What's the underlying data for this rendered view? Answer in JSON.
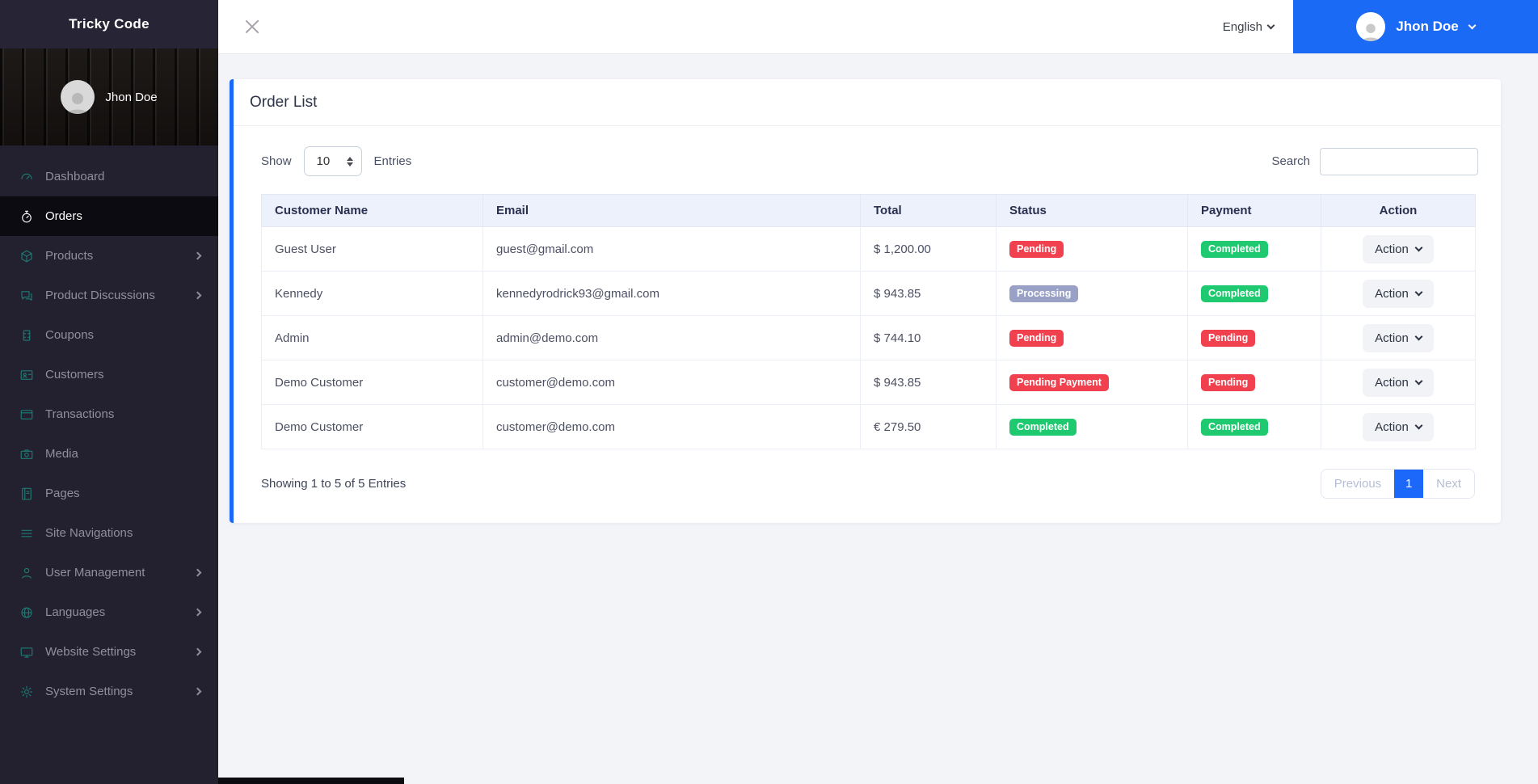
{
  "brand": "Tricky Code",
  "sidebar": {
    "user": {
      "name": "Jhon Doe"
    },
    "items": [
      {
        "label": "Dashboard",
        "icon": "gauge-icon",
        "active": false,
        "has_submenu": false
      },
      {
        "label": "Orders",
        "icon": "stopwatch-icon",
        "active": true,
        "has_submenu": false
      },
      {
        "label": "Products",
        "icon": "cube-icon",
        "active": false,
        "has_submenu": true
      },
      {
        "label": "Product Discussions",
        "icon": "chat-icon",
        "active": false,
        "has_submenu": true
      },
      {
        "label": "Coupons",
        "icon": "ticket-icon",
        "active": false,
        "has_submenu": false
      },
      {
        "label": "Customers",
        "icon": "id-card-icon",
        "active": false,
        "has_submenu": false
      },
      {
        "label": "Transactions",
        "icon": "credit-card-icon",
        "active": false,
        "has_submenu": false
      },
      {
        "label": "Media",
        "icon": "camera-icon",
        "active": false,
        "has_submenu": false
      },
      {
        "label": "Pages",
        "icon": "book-icon",
        "active": false,
        "has_submenu": false
      },
      {
        "label": "Site Navigations",
        "icon": "menu-lines-icon",
        "active": false,
        "has_submenu": false
      },
      {
        "label": "User Management",
        "icon": "person-icon",
        "active": false,
        "has_submenu": true
      },
      {
        "label": "Languages",
        "icon": "globe-icon",
        "active": false,
        "has_submenu": true
      },
      {
        "label": "Website Settings",
        "icon": "monitor-icon",
        "active": false,
        "has_submenu": true
      },
      {
        "label": "System Settings",
        "icon": "gear-icon",
        "active": false,
        "has_submenu": true
      }
    ]
  },
  "topbar": {
    "language": "English",
    "user_name": "Jhon Doe"
  },
  "page": {
    "card_title": "Order List",
    "show_label": "Show",
    "page_size": "10",
    "entries_label": "Entries",
    "search_label": "Search",
    "search_value": "",
    "table": {
      "columns": [
        "Customer Name",
        "Email",
        "Total",
        "Status",
        "Payment",
        "Action"
      ],
      "rows": [
        {
          "customer": "Guest User",
          "email": "guest@gmail.com",
          "total": "$ 1,200.00",
          "status": "Pending",
          "status_type": "danger",
          "payment": "Completed",
          "payment_type": "success",
          "action": "Action"
        },
        {
          "customer": "Kennedy",
          "email": "kennedyrodrick93@gmail.com",
          "total": "$ 943.85",
          "status": "Processing",
          "status_type": "processing",
          "payment": "Completed",
          "payment_type": "success",
          "action": "Action"
        },
        {
          "customer": "Admin",
          "email": "admin@demo.com",
          "total": "$ 744.10",
          "status": "Pending",
          "status_type": "danger",
          "payment": "Pending",
          "payment_type": "danger",
          "action": "Action"
        },
        {
          "customer": "Demo Customer",
          "email": "customer@demo.com",
          "total": "$ 943.85",
          "status": "Pending Payment",
          "status_type": "danger",
          "payment": "Pending",
          "payment_type": "danger",
          "action": "Action"
        },
        {
          "customer": "Demo Customer",
          "email": "customer@demo.com",
          "total": "€ 279.50",
          "status": "Completed",
          "status_type": "success",
          "payment": "Completed",
          "payment_type": "success",
          "action": "Action"
        }
      ]
    },
    "summary": "Showing 1 to 5 of 5 Entries",
    "pagination": {
      "previous": "Previous",
      "current_page": "1",
      "next": "Next"
    }
  },
  "colors": {
    "accent_blue": "#1a6af5",
    "card_border_blue": "#1b68fa",
    "sidebar_bg": "#232130",
    "sidebar_active_bg": "#0c0b11",
    "sidebar_icon_teal": "#1e7b73",
    "badge_danger": "#f1414f",
    "badge_success": "#1fc96f",
    "badge_processing": "#99a1c7",
    "table_header_bg": "#edf1fb"
  }
}
